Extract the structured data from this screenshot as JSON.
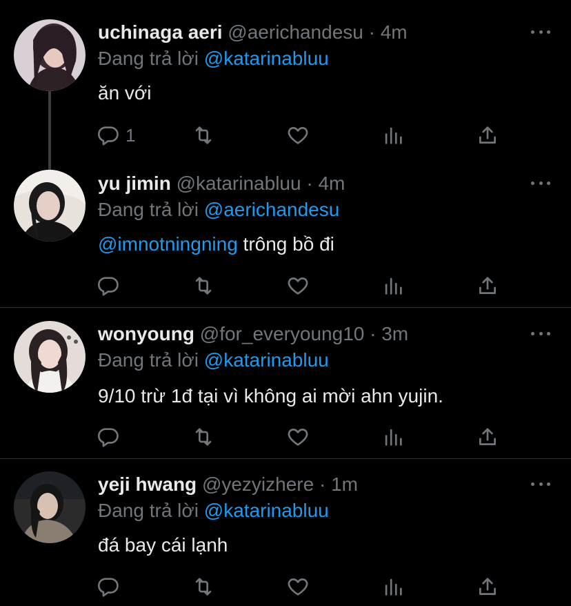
{
  "replying_label": "Đang trả lời",
  "tweets": [
    {
      "name": "uchinaga aeri",
      "handle": "@aerichandesu",
      "dot": "·",
      "time": "4m",
      "replying_to": "@katarinabluu",
      "text_mention": "",
      "text": "ăn với",
      "reply_count": "1",
      "avatar_colors": [
        "#d9cfd6",
        "#3a2a32"
      ]
    },
    {
      "name": "yu jimin",
      "handle": "@katarinabluu",
      "dot": "·",
      "time": "4m",
      "replying_to": "@aerichandesu",
      "text_mention": "@imnotningning",
      "text": " trông bồ đi",
      "reply_count": "",
      "avatar_colors": [
        "#e8e2dc",
        "#1a1a1a"
      ]
    },
    {
      "name": "wonyoung",
      "handle": "@for_everyoung10",
      "dot": "·",
      "time": "3m",
      "replying_to": "@katarinabluu",
      "text_mention": "",
      "text": "9/10 trừ 1đ tại vì không ai mời ahn yujin.",
      "reply_count": "",
      "avatar_colors": [
        "#e4dcd8",
        "#2a2222"
      ]
    },
    {
      "name": "yeji hwang",
      "handle": "@yezyizhere",
      "dot": "·",
      "time": "1m",
      "replying_to": "@katarinabluu",
      "text_mention": "",
      "text": "đá bay cái lạnh",
      "reply_count": "",
      "avatar_colors": [
        "#2b2b2b",
        "#8a7d72"
      ]
    }
  ]
}
